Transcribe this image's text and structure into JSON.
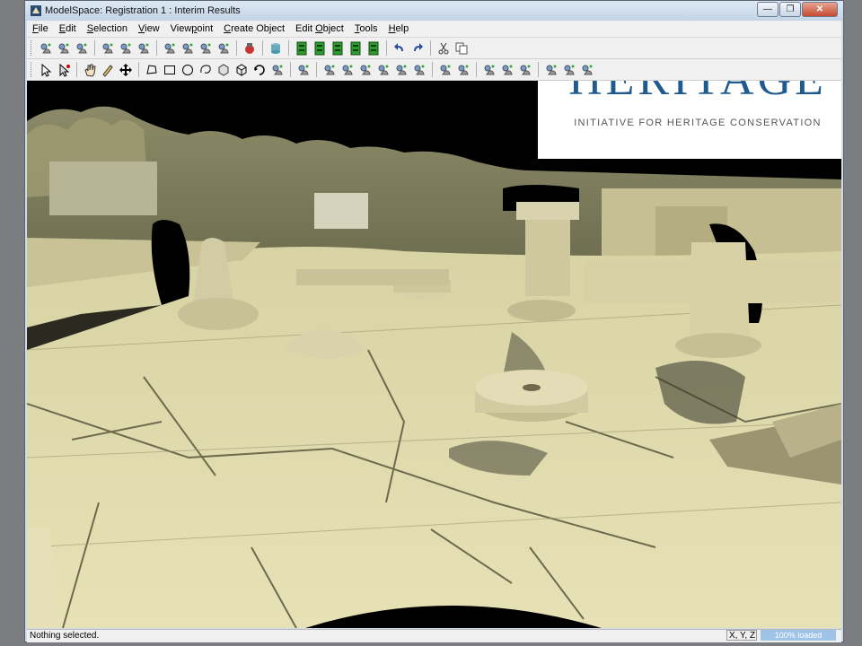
{
  "window": {
    "title": "ModelSpace: Registration 1 : Interim Results"
  },
  "window_controls": [
    "minimize",
    "restore",
    "close"
  ],
  "menubar": [
    {
      "label": "File",
      "key": "F"
    },
    {
      "label": "Edit",
      "key": "E"
    },
    {
      "label": "Selection",
      "key": "S"
    },
    {
      "label": "View",
      "key": "V"
    },
    {
      "label": "Viewpoint",
      "key": "p"
    },
    {
      "label": "Create Object",
      "key": "C"
    },
    {
      "label": "Edit Object",
      "key": "O"
    },
    {
      "label": "Tools",
      "key": "T"
    },
    {
      "label": "Help",
      "key": "H"
    }
  ],
  "toolbar_row1": [
    "new-cloud-icon",
    "add-cloud-icon",
    "filter-icon",
    "scan-world-icon",
    "layer-icon",
    "eye-icon",
    "seek-icon",
    "seek-icon",
    "hide-icon",
    "show-icon",
    "registration-icon",
    "database-icon",
    "green-view-1-icon",
    "green-view-2-icon",
    "green-view-3-icon",
    "green-view-4-icon",
    "green-view-5-icon",
    "undo-icon",
    "redo-icon",
    "cut-icon",
    "copy-icon"
  ],
  "toolbar_row2": [
    "select-arrow-icon",
    "select-point-icon",
    "hand-pan-icon",
    "pencil-icon",
    "move-icon",
    "polygon-fence-icon",
    "rect-fence-icon",
    "circle-fence-icon",
    "lasso-icon",
    "box-icon",
    "cube-icon",
    "rotate-icon",
    "measure-icon",
    "point-icon",
    "cloud-tool-1-icon",
    "cloud-tool-2-icon",
    "cloud-tool-3-icon",
    "cloud-tool-4-icon",
    "cloud-tool-5-icon",
    "cloud-tool-6-icon",
    "cloud-tool-7-icon",
    "cloud-tool-8-icon",
    "cloud-tool-9-icon",
    "cloud-tool-10-icon",
    "cloud-tool-11-icon",
    "cloud-tool-12-icon",
    "cloud-tool-13-icon",
    "cloud-tool-14-icon"
  ],
  "status": {
    "text": "Nothing selected.",
    "coords": "X, Y, Z",
    "progress_text": "100% loaded"
  },
  "logo": {
    "wordmark": "HERITAGE",
    "subtitle": "INITIATIVE FOR HERITAGE CONSERVATION",
    "color": "#1f5b8f"
  },
  "colors": {
    "stone": "#cfc9a0",
    "shadow": "#3e3e30",
    "sky": "#000000",
    "accent": "#1f5b8f"
  }
}
